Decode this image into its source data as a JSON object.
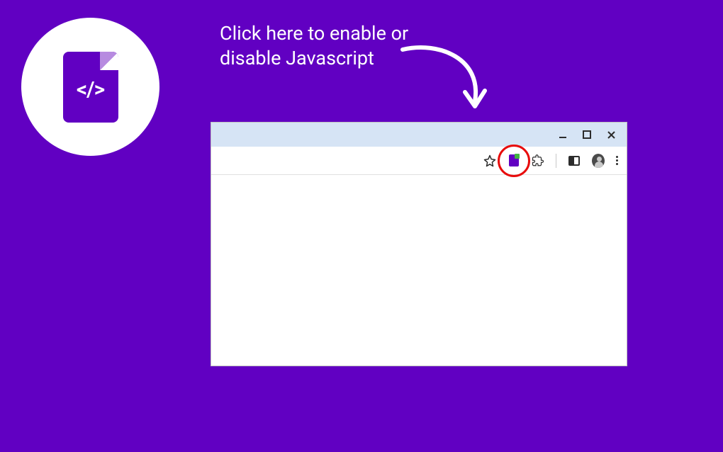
{
  "colors": {
    "background": "#6100c2",
    "highlight_ring": "#e80b0b"
  },
  "logo": {
    "glyph": "</>"
  },
  "instruction": {
    "text": "Click here to enable or disable Javascript"
  },
  "browser": {
    "window_controls": {
      "minimize": "_",
      "maximize": "□",
      "close": "×"
    },
    "toolbar": {
      "star_title": "Bookmark",
      "extension_title": "JavaScript toggle extension",
      "puzzle_title": "Extensions",
      "split_title": "Side panel",
      "avatar_title": "Profile",
      "menu_title": "Menu"
    }
  }
}
